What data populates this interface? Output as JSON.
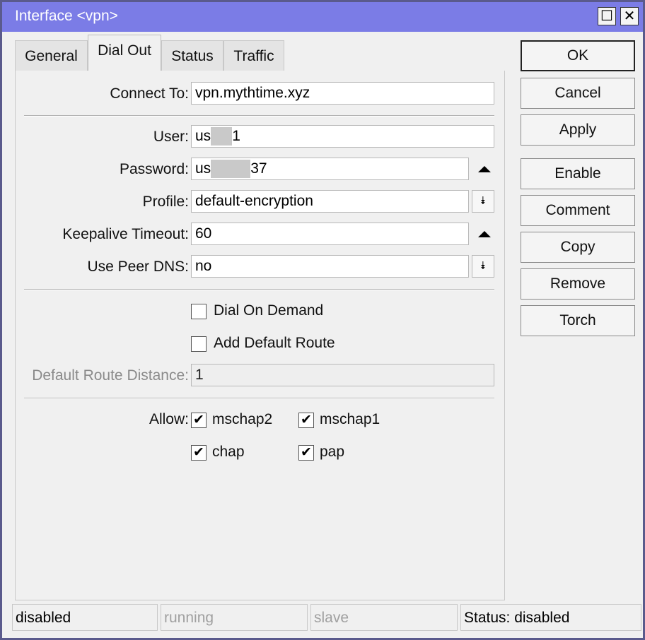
{
  "window": {
    "title": "Interface <vpn>",
    "maximize_glyph": "☐",
    "close_glyph": "✕"
  },
  "tabs": [
    {
      "label": "General",
      "active": false
    },
    {
      "label": "Dial Out",
      "active": true
    },
    {
      "label": "Status",
      "active": false
    },
    {
      "label": "Traffic",
      "active": false
    }
  ],
  "form": {
    "connect_to": {
      "label": "Connect To:",
      "value": "vpn.mythtime.xyz"
    },
    "user": {
      "label": "User:",
      "value_start": "us",
      "value_end": "1"
    },
    "password": {
      "label": "Password:",
      "value_start": "us",
      "value_end": "37"
    },
    "profile": {
      "label": "Profile:",
      "value": "default-encryption"
    },
    "keepalive_timeout": {
      "label": "Keepalive Timeout:",
      "value": "60"
    },
    "use_peer_dns": {
      "label": "Use Peer DNS:",
      "value": "no"
    },
    "dial_on_demand": {
      "label": "Dial On Demand",
      "checked": false
    },
    "add_default_route": {
      "label": "Add Default Route",
      "checked": false
    },
    "default_route_distance": {
      "label": "Default Route Distance:",
      "value": "1"
    },
    "allow": {
      "label": "Allow:",
      "options": [
        {
          "label": "mschap2",
          "checked": true
        },
        {
          "label": "mschap1",
          "checked": true
        },
        {
          "label": "chap",
          "checked": true
        },
        {
          "label": "pap",
          "checked": true
        }
      ]
    }
  },
  "icons": {
    "check_glyph": "✔",
    "dropdown_glyph": "⯯"
  },
  "buttons": {
    "ok": "OK",
    "cancel": "Cancel",
    "apply": "Apply",
    "enable": "Enable",
    "comment": "Comment",
    "copy": "Copy",
    "remove": "Remove",
    "torch": "Torch"
  },
  "statusbar": {
    "state": "disabled",
    "running": "running",
    "slave": "slave",
    "status": "Status: disabled"
  }
}
